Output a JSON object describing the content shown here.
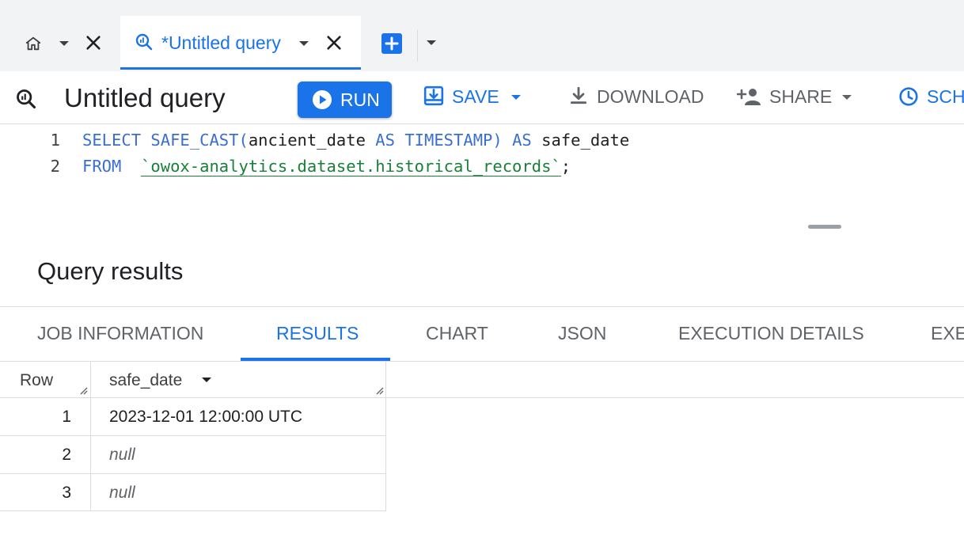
{
  "tabs": {
    "query_tab_title": "*Untitled query"
  },
  "toolbar": {
    "title": "Untitled query",
    "run_label": "RUN",
    "save_label": "SAVE",
    "download_label": "DOWNLOAD",
    "share_label": "SHARE",
    "schedule_label": "SCH"
  },
  "editor": {
    "line_numbers": [
      "1",
      "2"
    ],
    "line1": {
      "kw1": "SELECT",
      "fn": "SAFE_CAST(",
      "col": "ancient_date",
      "kw2": "AS",
      "kw3": "TIMESTAMP)",
      "kw4": "AS",
      "alias": "safe_date"
    },
    "line2": {
      "kw1": "FROM",
      "table": "`owox-analytics.dataset.historical_records`",
      "end": ";"
    }
  },
  "results": {
    "title": "Query results",
    "tabs": [
      "JOB INFORMATION",
      "RESULTS",
      "CHART",
      "JSON",
      "EXECUTION DETAILS",
      "EXE"
    ],
    "active_tab": "RESULTS",
    "columns": [
      "Row",
      "safe_date"
    ],
    "rows": [
      {
        "row": "1",
        "safe_date": "2023-12-01 12:00:00 UTC"
      },
      {
        "row": "2",
        "safe_date": "null"
      },
      {
        "row": "3",
        "safe_date": "null"
      }
    ]
  },
  "colors": {
    "accent": "#1a73e8",
    "keyword": "#3a6fd0",
    "string": "#188038"
  },
  "icons": [
    "home-icon",
    "query-icon",
    "close-icon",
    "add-tab-icon",
    "run-play-icon",
    "save-icon",
    "download-icon",
    "share-icon",
    "schedule-clock-icon",
    "sort-caret-icon",
    "column-resize-grip-icon"
  ]
}
